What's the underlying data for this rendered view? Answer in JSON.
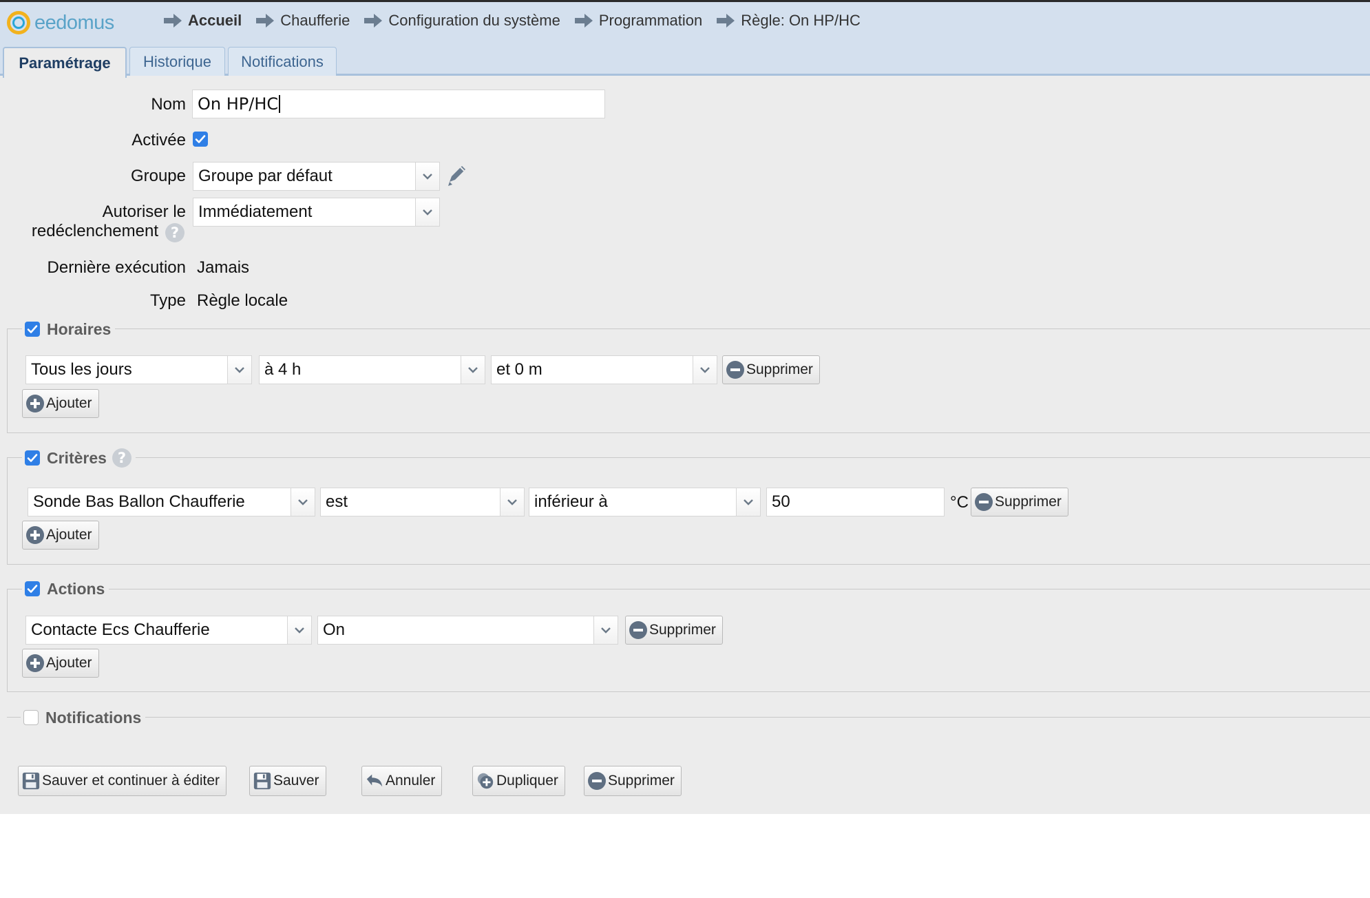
{
  "brand": {
    "name": "eedomus"
  },
  "breadcrumb": [
    "Accueil",
    "Chaufferie",
    "Configuration du système",
    "Programmation",
    "Règle: On HP/HC"
  ],
  "tabs": [
    "Paramétrage",
    "Historique",
    "Notifications"
  ],
  "form": {
    "nom_label": "Nom",
    "nom_value": "On HP/HC",
    "activee_label": "Activée",
    "activee_checked": true,
    "groupe_label": "Groupe",
    "groupe_value": "Groupe par défaut",
    "redecl_label_line1": "Autoriser le",
    "redecl_label_line2": "redéclenchement",
    "redecl_value": "Immédiatement",
    "derniere_label": "Dernière exécution",
    "derniere_value": "Jamais",
    "type_label": "Type",
    "type_value": "Règle locale"
  },
  "horaires": {
    "title": "Horaires",
    "checked": true,
    "jour": "Tous les jours",
    "heure": "à 4 h",
    "minute": "et 0 m",
    "delete_label": "Supprimer",
    "add_label": "Ajouter"
  },
  "criteres": {
    "title": "Critères",
    "checked": true,
    "device": "Sonde Bas Ballon Chaufferie",
    "verb": "est",
    "comparator": "inférieur à",
    "value": "50",
    "unit": "°C",
    "delete_label": "Supprimer",
    "add_label": "Ajouter"
  },
  "actions": {
    "title": "Actions",
    "checked": true,
    "device": "Contacte Ecs Chaufferie",
    "value": "On",
    "delete_label": "Supprimer",
    "add_label": "Ajouter"
  },
  "notifications": {
    "title": "Notifications",
    "checked": false
  },
  "footer": {
    "save_continue": "Sauver et continuer à éditer",
    "save": "Sauver",
    "cancel": "Annuler",
    "duplicate": "Dupliquer",
    "delete": "Supprimer"
  },
  "colors": {
    "accent": "#2f7fe6",
    "header_bg": "#d4e0ee",
    "panel_bg": "#ececec"
  }
}
